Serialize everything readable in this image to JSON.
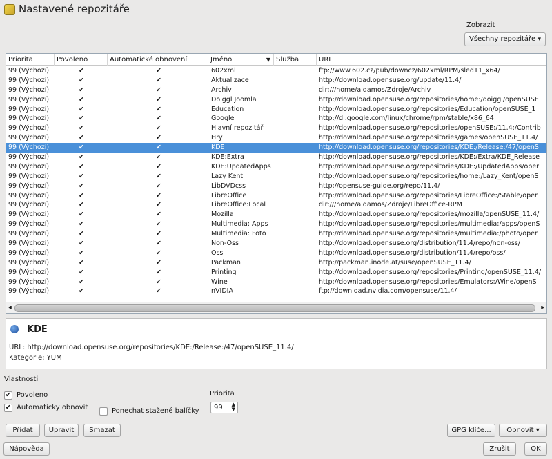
{
  "window": {
    "title": "Nastavené repozitáře"
  },
  "filter": {
    "label": "Zobrazit",
    "selected": "Všechny repozitáře"
  },
  "table": {
    "columns": [
      "Priorita",
      "Povoleno",
      "Automatické obnovení",
      "Jméno",
      "Služba",
      "URL"
    ],
    "rows": [
      {
        "priority": "99 (Výchozí)",
        "enabled": "✔",
        "auto": "✔",
        "name": "602xml",
        "service": "",
        "url": "ftp://www.602.cz/pub/downcz/602xml/RPM/sled11_x64/"
      },
      {
        "priority": "99 (Výchozí)",
        "enabled": "✔",
        "auto": "✔",
        "name": "Aktualizace",
        "service": "",
        "url": "http://download.opensuse.org/update/11.4/"
      },
      {
        "priority": "99 (Výchozí)",
        "enabled": "✔",
        "auto": "✔",
        "name": "Archiv",
        "service": "",
        "url": "dir:///home/aidamos/Zdroje/Archiv"
      },
      {
        "priority": "99 (Výchozí)",
        "enabled": "✔",
        "auto": "✔",
        "name": "Doiggl Joomla",
        "service": "",
        "url": "http://download.opensuse.org/repositories/home:/doiggl/openSUSE"
      },
      {
        "priority": "99 (Výchozí)",
        "enabled": "✔",
        "auto": "✔",
        "name": "Education",
        "service": "",
        "url": "http://download.opensuse.org/repositories/Education/openSUSE_1"
      },
      {
        "priority": "99 (Výchozí)",
        "enabled": "✔",
        "auto": "✔",
        "name": "Google",
        "service": "",
        "url": "http://dl.google.com/linux/chrome/rpm/stable/x86_64"
      },
      {
        "priority": "99 (Výchozí)",
        "enabled": "✔",
        "auto": "✔",
        "name": "Hlavní repozitář",
        "service": "",
        "url": "http://download.opensuse.org/repositories/openSUSE:/11.4:/Contrib"
      },
      {
        "priority": "99 (Výchozí)",
        "enabled": "✔",
        "auto": "✔",
        "name": "Hry",
        "service": "",
        "url": "http://download.opensuse.org/repositories/games/openSUSE_11.4/"
      },
      {
        "priority": "99 (Výchozí)",
        "enabled": "✔",
        "auto": "✔",
        "name": "KDE",
        "service": "",
        "url": "http://download.opensuse.org/repositories/KDE:/Release:/47/openS"
      },
      {
        "priority": "99 (Výchozí)",
        "enabled": "✔",
        "auto": "✔",
        "name": "KDE:Extra",
        "service": "",
        "url": "http://download.opensuse.org/repositories/KDE:/Extra/KDE_Release"
      },
      {
        "priority": "99 (Výchozí)",
        "enabled": "✔",
        "auto": "✔",
        "name": "KDE:UpdatedApps",
        "service": "",
        "url": "http://download.opensuse.org/repositories/KDE:/UpdatedApps/oper"
      },
      {
        "priority": "99 (Výchozí)",
        "enabled": "✔",
        "auto": "✔",
        "name": "Lazy Kent",
        "service": "",
        "url": "http://download.opensuse.org/repositories/home:/Lazy_Kent/openS"
      },
      {
        "priority": "99 (Výchozí)",
        "enabled": "✔",
        "auto": "✔",
        "name": "LibDVDcss",
        "service": "",
        "url": "http://opensuse-guide.org/repo/11.4/"
      },
      {
        "priority": "99 (Výchozí)",
        "enabled": "✔",
        "auto": "✔",
        "name": "LibreOffice",
        "service": "",
        "url": "http://download.opensuse.org/repositories/LibreOffice:/Stable/oper"
      },
      {
        "priority": "99 (Výchozí)",
        "enabled": "✔",
        "auto": "✔",
        "name": "LibreOffice:Local",
        "service": "",
        "url": "dir:///home/aidamos/Zdroje/LibreOffice-RPM"
      },
      {
        "priority": "99 (Výchozí)",
        "enabled": "✔",
        "auto": "✔",
        "name": "Mozilla",
        "service": "",
        "url": "http://download.opensuse.org/repositories/mozilla/openSUSE_11.4/"
      },
      {
        "priority": "99 (Výchozí)",
        "enabled": "✔",
        "auto": "✔",
        "name": "Multimedia: Apps",
        "service": "",
        "url": "http://download.opensuse.org/repositories/multimedia:/apps/openS"
      },
      {
        "priority": "99 (Výchozí)",
        "enabled": "✔",
        "auto": "✔",
        "name": "Multimedia: Foto",
        "service": "",
        "url": "http://download.opensuse.org/repositories/multimedia:/photo/oper"
      },
      {
        "priority": "99 (Výchozí)",
        "enabled": "✔",
        "auto": "✔",
        "name": "Non-Oss",
        "service": "",
        "url": "http://download.opensuse.org/distribution/11.4/repo/non-oss/"
      },
      {
        "priority": "99 (Výchozí)",
        "enabled": "✔",
        "auto": "✔",
        "name": "Oss",
        "service": "",
        "url": "http://download.opensuse.org/distribution/11.4/repo/oss/"
      },
      {
        "priority": "99 (Výchozí)",
        "enabled": "✔",
        "auto": "✔",
        "name": "Packman",
        "service": "",
        "url": "http://packman.inode.at/suse/openSUSE_11.4/"
      },
      {
        "priority": "99 (Výchozí)",
        "enabled": "✔",
        "auto": "✔",
        "name": "Printing",
        "service": "",
        "url": "http://download.opensuse.org/repositories/Printing/openSUSE_11.4/"
      },
      {
        "priority": "99 (Výchozí)",
        "enabled": "✔",
        "auto": "✔",
        "name": "Wine",
        "service": "",
        "url": "http://download.opensuse.org/repositories/Emulators:/Wine/openS"
      },
      {
        "priority": "99 (Výchozí)",
        "enabled": "✔",
        "auto": "✔",
        "name": "nVIDIA",
        "service": "",
        "url": "ftp://download.nvidia.com/opensuse/11.4/"
      }
    ],
    "selected_row": 8
  },
  "details": {
    "name": "KDE",
    "url_line": "URL: http://download.opensuse.org/repositories/KDE:/Release:/47/openSUSE_11.4/",
    "category_line": "Kategorie: YUM"
  },
  "properties": {
    "label": "Vlastnosti",
    "enabled_label": "Povoleno",
    "enabled_checked": true,
    "auto_refresh_label": "Automaticky obnovit",
    "auto_refresh_checked": true,
    "keep_packages_label": "Ponechat stažené balíčky",
    "keep_packages_checked": false,
    "priority_label": "Priorita",
    "priority_value": "99"
  },
  "buttons": {
    "add": "Přidat",
    "edit": "Upravit",
    "delete": "Smazat",
    "gpg": "GPG klíče...",
    "refresh": "Obnovit",
    "help": "Nápověda",
    "cancel": "Zrušit",
    "ok": "OK"
  }
}
